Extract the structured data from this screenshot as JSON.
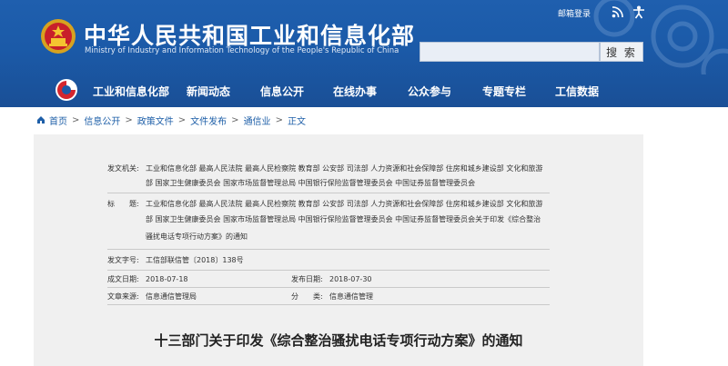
{
  "header": {
    "title": "中华人民共和国工业和信息化部",
    "subtitle": "Ministry of Industry and Information Technology of the People's Republic of China",
    "mail_login": "邮箱登录",
    "search_button": "搜 索",
    "search_placeholder": ""
  },
  "nav": {
    "items": [
      "工业和信息化部",
      "新闻动态",
      "信息公开",
      "在线办事",
      "公众参与",
      "专题专栏",
      "工信数据"
    ]
  },
  "breadcrumb": [
    "首页",
    "信息公开",
    "政策文件",
    "文件发布",
    "通信业",
    "正文"
  ],
  "meta": {
    "issuer_label": "发文机关:",
    "issuer_line1": "工业和信息化部 最高人民法院 最高人民检察院 教育部 公安部 司法部 人力资源和社会保障部 住房和城乡建设部 文化和旅游",
    "issuer_line2": "部 国家卫生健康委员会 国家市场监督管理总局 中国银行保险监督管理委员会 中国证券监督管理委员会",
    "title_label": "标　　题:",
    "title_line1": "工业和信息化部 最高人民法院 最高人民检察院 教育部 公安部 司法部 人力资源和社会保障部 住房和城乡建设部 文化和旅游",
    "title_line2": "部 国家卫生健康委员会 国家市场监督管理总局 中国银行保险监督管理委员会 中国证券监督管理委员会关于印发《综合整治",
    "title_line3": "骚扰电话专项行动方案》的通知",
    "doc_no_label": "发文字号:",
    "doc_no": "工信部联信管〔2018〕138号",
    "created_label": "成文日期:",
    "created": "2018-07-18",
    "published_label": "发布日期:",
    "published": "2018-07-30",
    "source_label": "文章来源:",
    "source": "信息通信管理局",
    "category_label": "分　　类:",
    "category": "信息通信管理"
  },
  "document_title": "十三部门关于印发《综合整治骚扰电话专项行动方案》的通知",
  "colors": {
    "header_blue": "#1b5aa8",
    "link_blue": "#1e5fa8",
    "panel_gray": "#f0f0f0"
  }
}
